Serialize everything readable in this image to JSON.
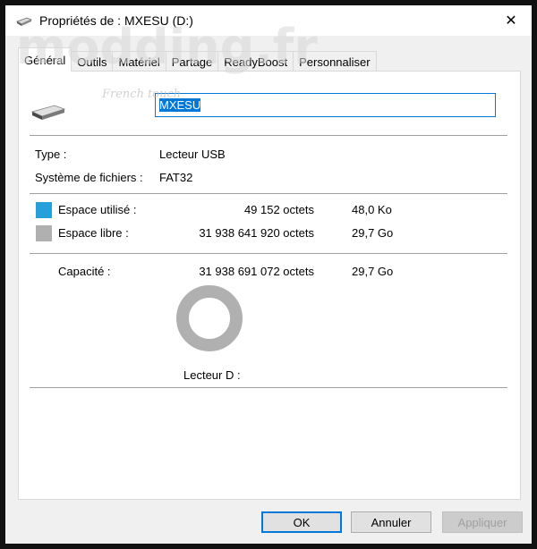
{
  "window": {
    "title": "Propriétés de : MXESU (D:)",
    "close_glyph": "✕"
  },
  "watermark": {
    "logo_text": "modding.fr",
    "tagline": "French touch"
  },
  "tabs": [
    {
      "label": "Général",
      "active": true
    },
    {
      "label": "Outils",
      "active": false
    },
    {
      "label": "Matériel",
      "active": false
    },
    {
      "label": "Partage",
      "active": false
    },
    {
      "label": "ReadyBoost",
      "active": false
    },
    {
      "label": "Personnaliser",
      "active": false
    }
  ],
  "general": {
    "drive_name": "MXESU",
    "type_label": "Type :",
    "type_value": "Lecteur USB",
    "fs_label": "Système de fichiers :",
    "fs_value": "FAT32",
    "used": {
      "label": "Espace utilisé :",
      "bytes": "49 152 octets",
      "size": "48,0 Ko",
      "color": "#26a0da"
    },
    "free": {
      "label": "Espace libre :",
      "bytes": "31 938 641 920 octets",
      "size": "29,7 Go",
      "color": "#b0b0b0"
    },
    "capacity": {
      "label": "Capacité :",
      "bytes": "31 938 691 072 octets",
      "size": "29,7 Go"
    },
    "drive_caption": "Lecteur D :",
    "usage_fraction": 1.5e-06
  },
  "footer": {
    "ok": "OK",
    "cancel": "Annuler",
    "apply": "Appliquer"
  },
  "icons": {
    "title": "usb-drive-icon",
    "drive": "usb-drive-icon",
    "close": "close-icon"
  }
}
